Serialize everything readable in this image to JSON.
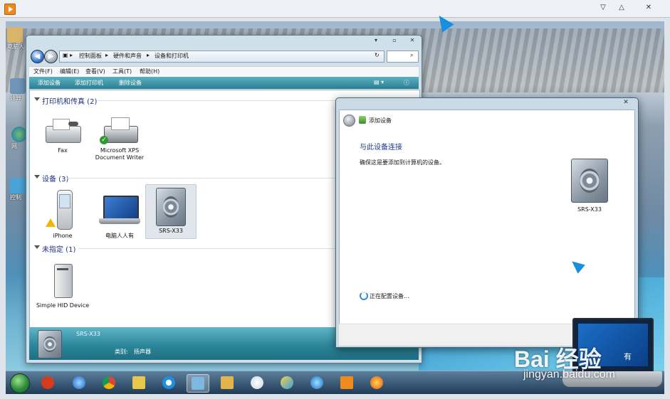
{
  "explorer": {
    "address": {
      "crumbs": [
        "控制面板",
        "硬件和声音",
        "设备和打印机"
      ]
    },
    "menu": [
      "文件(F)",
      "编辑(E)",
      "查看(V)",
      "工具(T)",
      "帮助(H)"
    ],
    "commands": [
      "添加设备",
      "添加打印机",
      "删除设备"
    ],
    "groups": [
      {
        "title": "打印机和传真 (2)",
        "items": [
          {
            "label": "Fax",
            "icon": "fax-icon"
          },
          {
            "label": "Microsoft XPS Document Writer",
            "icon": "printer-icon"
          }
        ]
      },
      {
        "title": "设备 (3)",
        "items": [
          {
            "label": "iPhone",
            "icon": "phone-icon"
          },
          {
            "label": "电脑人人有",
            "icon": "laptop-icon"
          },
          {
            "label": "SRS-X33",
            "icon": "speaker-icon"
          }
        ]
      },
      {
        "title": "未指定 (1)",
        "items": [
          {
            "label": "Simple HID Device",
            "icon": "hid-device-icon"
          }
        ]
      }
    ],
    "details": {
      "name": "SRS-X33",
      "category_label": "类别:",
      "category_value": "扬声器"
    }
  },
  "dialog": {
    "title": "添加设备",
    "heading": "与此设备连接",
    "description": "确保这是要添加到计算机的设备。",
    "device_label": "SRS-X33",
    "status": "正在配置设备..."
  },
  "desktop": {
    "icons": [
      "电脑人",
      "计算",
      "网",
      "控制"
    ]
  },
  "watermark": {
    "brand": "Bai 经验",
    "url": "jingyan.baidu.com",
    "caption": "有"
  },
  "taskbar": {
    "apps": [
      "start-orb",
      "app-red-icon",
      "ie-icon",
      "chrome-icon",
      "folder-notes-icon",
      "qq-browser-icon",
      "control-panel-icon",
      "folder-icon",
      "tools-icon",
      "paint-icon",
      "media-icon",
      "video-player-icon",
      "firefox-icon"
    ]
  }
}
